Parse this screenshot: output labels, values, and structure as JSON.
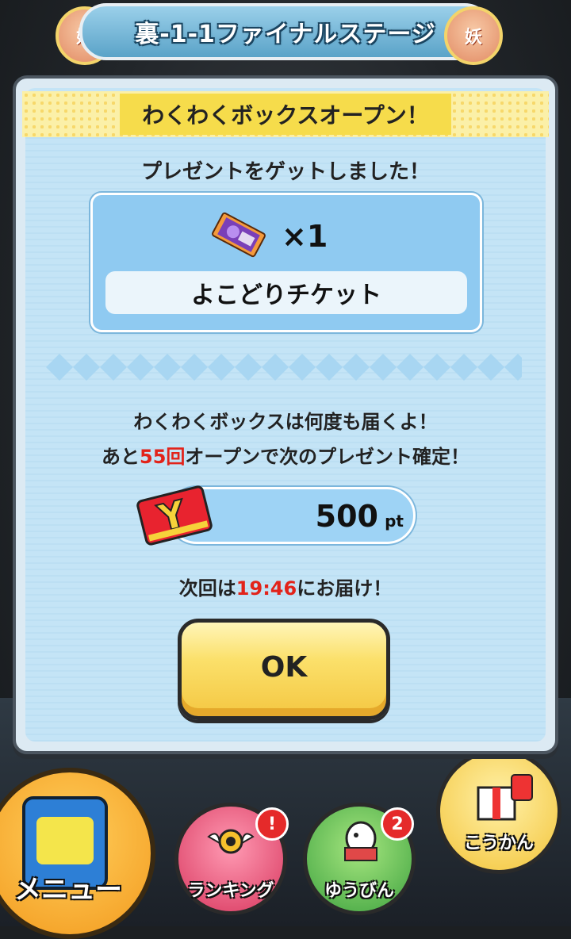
{
  "header": {
    "stage_title": "裏-1-1ファイナルステージ",
    "emblem_text": "妖"
  },
  "dialog": {
    "title": "わくわくボックスオープン！",
    "subtitle": "プレゼントをゲットしました！",
    "prize": {
      "icon": "ticket-icon",
      "quantity": "×1",
      "name": "よこどりチケット"
    },
    "info_line1": "わくわくボックスは何度も届くよ！",
    "info_line2_prefix": "あと",
    "info_line2_count": "55回",
    "info_line2_suffix": "オープンで次のプレゼント確定！",
    "points_value": "500",
    "points_unit": "pt",
    "next_prefix": "次回は",
    "next_time": "19:46",
    "next_suffix": "にお届け！",
    "ok_label": "OK"
  },
  "bottom_menu": {
    "menu_label": "メニュー",
    "ranking_label": "ランキング",
    "ranking_badge": "!",
    "post_label": "ゆうびん",
    "post_badge": "2",
    "exchange_label": "こうかん"
  },
  "colors": {
    "accent_red": "#e2231a",
    "dialog_bg": "#c4e4f6",
    "title_band": "#f6dc4b",
    "ok_button": "#fbe06a"
  }
}
